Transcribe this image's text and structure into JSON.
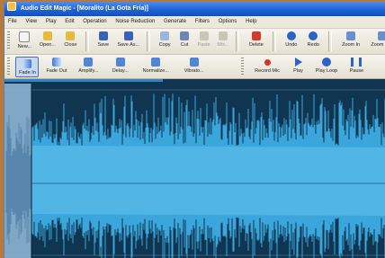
{
  "window": {
    "title": "Audio Edit Magic - [Moralito (La Gota Fria)]"
  },
  "menu": [
    "File",
    "View",
    "Play",
    "Edit",
    "Operation",
    "Noise Reduction",
    "Generate",
    "Filters",
    "Options",
    "Help"
  ],
  "toolbar1": [
    {
      "label": "New...",
      "icon": "new-file-icon",
      "color": "#f4f4f4"
    },
    {
      "label": "Open...",
      "icon": "open-folder-icon",
      "color": "#e8b93c"
    },
    {
      "label": "Close",
      "icon": "close-folder-icon",
      "color": "#e8b93c"
    },
    {
      "label": "Save",
      "icon": "save-disk-icon",
      "color": "#3a62b8"
    },
    {
      "label": "Save As...",
      "icon": "save-as-disk-icon",
      "color": "#3a62b8"
    },
    {
      "label": "Copy",
      "icon": "copy-icon",
      "color": "#9bb6dd"
    },
    {
      "label": "Cut",
      "icon": "scissors-icon",
      "color": "#6c86b8"
    },
    {
      "label": "Paste",
      "icon": "paste-icon",
      "color": "#c9c6b8"
    },
    {
      "label": "Mix...",
      "icon": "mix-icon",
      "color": "#c9c6b8"
    },
    {
      "label": "Delete",
      "icon": "delete-icon",
      "color": "#d23a2e"
    },
    {
      "label": "Undo",
      "icon": "undo-icon",
      "color": "#2b62c4"
    },
    {
      "label": "Redo",
      "icon": "redo-icon",
      "color": "#2b62c4"
    },
    {
      "label": "Zoom In",
      "icon": "zoom-in-icon",
      "color": "#6a8fd0"
    },
    {
      "label": "Zoom Out",
      "icon": "zoom-out-icon",
      "color": "#6a8fd0"
    }
  ],
  "toolbar2_effects": [
    {
      "label": "Fade In",
      "icon": "fade-in-icon",
      "color": "#3f7bd8"
    },
    {
      "label": "Fade Out",
      "icon": "fade-out-icon",
      "color": "#3f7bd8"
    },
    {
      "label": "Amplify...",
      "icon": "amplify-icon",
      "color": "#4f86d6"
    },
    {
      "label": "Delay...",
      "icon": "delay-icon",
      "color": "#4f86d6"
    },
    {
      "label": "Normalize...",
      "icon": "normalize-icon",
      "color": "#4f86d6"
    },
    {
      "label": "Vibrato...",
      "icon": "vibrato-icon",
      "color": "#4f86d6"
    }
  ],
  "toolbar2_transport": [
    {
      "label": "Record Mic",
      "icon": "record-icon",
      "color": "#d2332a"
    },
    {
      "label": "Play",
      "icon": "play-icon",
      "color": "#2b62c4"
    },
    {
      "label": "Play Loop",
      "icon": "play-loop-icon",
      "color": "#2b62c4"
    },
    {
      "label": "Pause",
      "icon": "pause-icon",
      "color": "#2b62c4"
    }
  ],
  "colors": {
    "wave_background": "#0f3550",
    "waveform": "#3aa6dc",
    "waveform_dense": "#56b8e6",
    "selection": "#9cc4e4"
  }
}
